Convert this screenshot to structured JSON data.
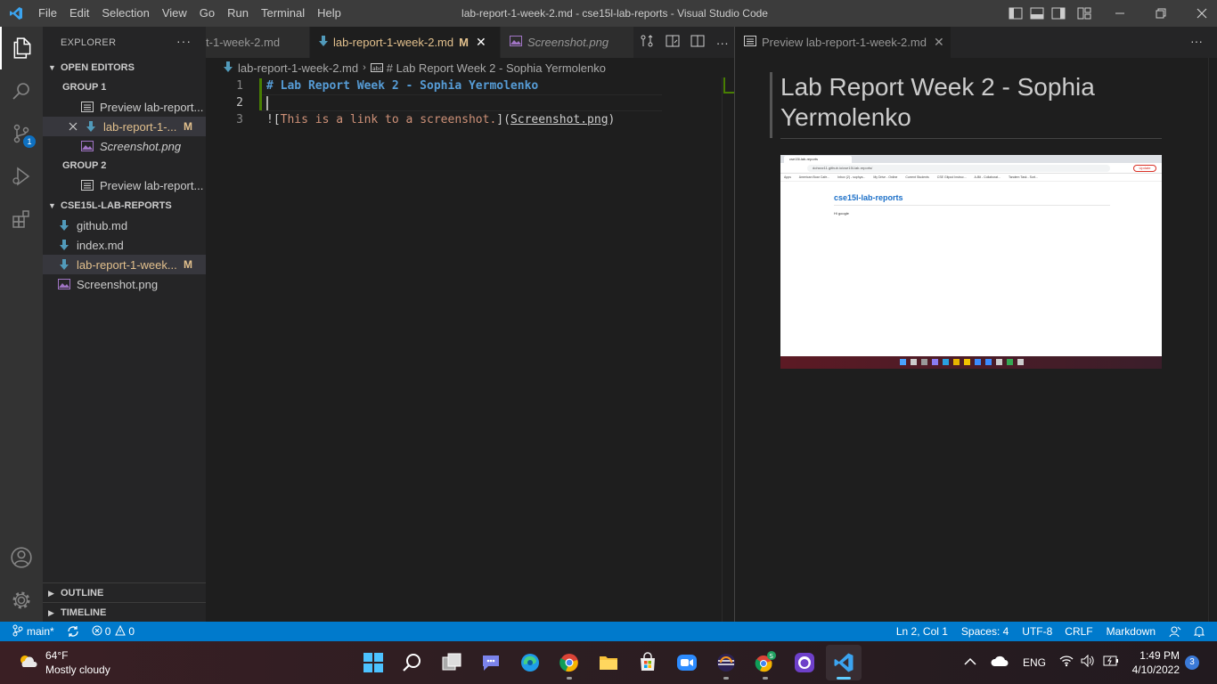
{
  "titlebar": {
    "menu": [
      "File",
      "Edit",
      "Selection",
      "View",
      "Go",
      "Run",
      "Terminal",
      "Help"
    ],
    "title": "lab-report-1-week-2.md - cse15l-lab-reports - Visual Studio Code"
  },
  "activity": {
    "scm_badge": "1"
  },
  "sidebar": {
    "header": "EXPLORER",
    "more": "···",
    "open_editors": "OPEN EDITORS",
    "group1": "GROUP 1",
    "group2": "GROUP 2",
    "open_items": [
      {
        "label": "Preview lab-report-1-week-2.md",
        "display": "Preview lab-report..."
      },
      {
        "label": "lab-report-1-week-2.md",
        "display": "lab-report-1-...",
        "mod": "M"
      },
      {
        "label": "Screenshot.png",
        "display": "Screenshot.png"
      },
      {
        "label": "Preview lab-report-1-week-2.md",
        "display": "Preview lab-report..."
      }
    ],
    "folder": "CSE15L-LAB-REPORTS",
    "files": [
      {
        "label": "github.md"
      },
      {
        "label": "index.md"
      },
      {
        "label": "lab-report-1-week...",
        "mod": "M"
      },
      {
        "label": "Screenshot.png"
      }
    ],
    "outline": "OUTLINE",
    "timeline": "TIMELINE"
  },
  "editor": {
    "tabs": [
      {
        "label": "t-1-week-2.md"
      },
      {
        "label": "lab-report-1-week-2.md",
        "mod": "M"
      },
      {
        "label": "Screenshot.png"
      }
    ],
    "breadcrumb": {
      "file": "lab-report-1-week-2.md",
      "symbol": "# Lab Report Week 2 - Sophia Yermolenko"
    },
    "lines": [
      {
        "num": "1",
        "text": "# Lab Report Week 2 - Sophia Yermolenko"
      },
      {
        "num": "2",
        "text": ""
      },
      {
        "num": "3",
        "alt": "This is a link to a screenshot.",
        "src": "Screenshot.png"
      }
    ]
  },
  "preview": {
    "tab_label": "Preview lab-report-1-week-2.md",
    "heading": "Lab Report Week 2 - Sophia Yermolenko",
    "shot": {
      "tab": "cse15l-lab-reports",
      "url": "dohzzz11.github.io/cse15l-lab-reports/",
      "site_title": "cse15l-lab-reports",
      "body": "Hi google",
      "bookmarks": [
        "Apps",
        "American Boar Cafe...",
        "Inbox (2) - sophya...",
        "My Drive - Online",
        "Current Students",
        "CSE Gitpod Instruc...",
        "A-Bit - Collaborat...",
        "Tandem Task - Sort..."
      ],
      "btn": "Update"
    }
  },
  "statusbar": {
    "branch": "main*",
    "errors": "0",
    "warnings": "0",
    "position": "Ln 2, Col 1",
    "spaces": "Spaces: 4",
    "encoding": "UTF-8",
    "eol": "CRLF",
    "language": "Markdown"
  },
  "taskbar": {
    "temp": "64°F",
    "weather": "Mostly cloudy",
    "lang": "ENG",
    "time": "1:49 PM",
    "date": "4/10/2022",
    "notif": "3"
  },
  "colors": {
    "accent": "#007acc",
    "heading_md": "#569cd6",
    "link_text": "#ce9178",
    "modified": "#e2c08d"
  }
}
